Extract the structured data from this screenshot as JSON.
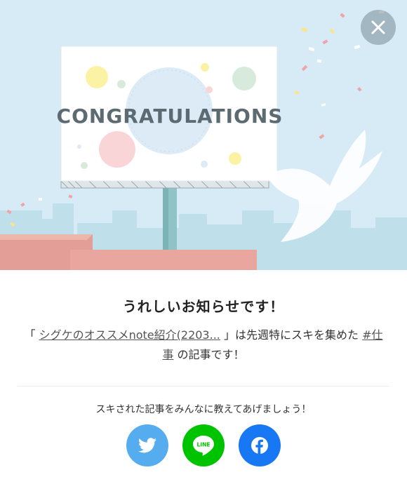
{
  "hero": {
    "billboard_text": "CONGRATULATIONS"
  },
  "close_button": {
    "icon": "close-icon"
  },
  "headline": "うれしいお知らせです！",
  "message": {
    "open_bracket": "「",
    "article_link": "シグケのオススメnote紹介(2203...",
    "close_bracket_text": "」は先週特にスキを集めた",
    "hashtag_link": "#仕事",
    "suffix": "の記事です！"
  },
  "share": {
    "prompt": "スキされた記事をみんなに教えてあげましょう！",
    "buttons": [
      {
        "name": "twitter",
        "icon": "twitter-icon",
        "color": "#55acee"
      },
      {
        "name": "line",
        "icon": "line-icon",
        "label": "LINE",
        "color": "#00c300"
      },
      {
        "name": "facebook",
        "icon": "facebook-icon",
        "color": "#1877f2"
      }
    ]
  }
}
